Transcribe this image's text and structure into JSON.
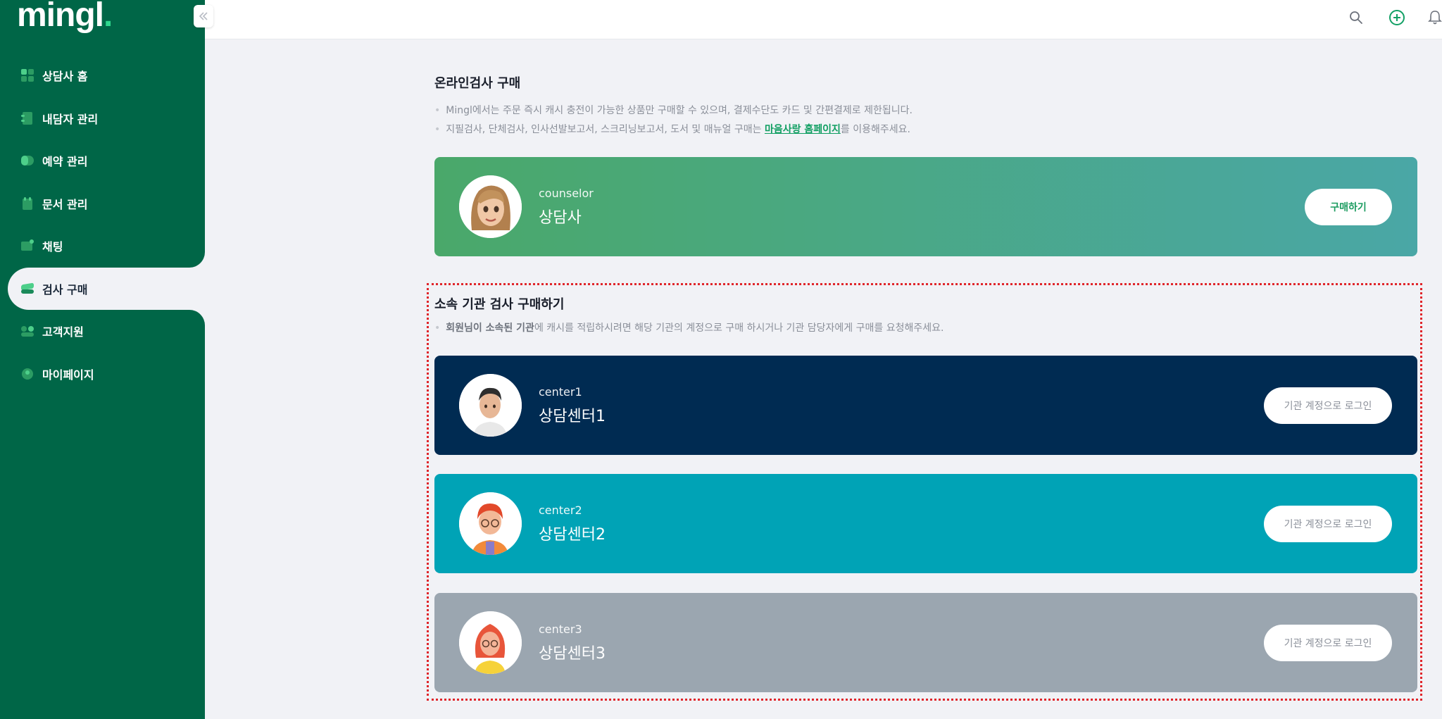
{
  "app": {
    "logo_text": "mingl",
    "logo_dot": "."
  },
  "sidebar": {
    "items": [
      {
        "label": "상담사 홈",
        "icon": "home-grid-icon",
        "active": false
      },
      {
        "label": "내담자 관리",
        "icon": "client-icon",
        "active": false
      },
      {
        "label": "예약 관리",
        "icon": "reservation-icon",
        "active": false
      },
      {
        "label": "문서 관리",
        "icon": "document-icon",
        "active": false
      },
      {
        "label": "채팅",
        "icon": "chat-icon",
        "active": false
      },
      {
        "label": "검사 구매",
        "icon": "stack-icon",
        "active": true
      },
      {
        "label": "고객지원",
        "icon": "support-icon",
        "active": false
      },
      {
        "label": "마이페이지",
        "icon": "user-icon",
        "active": false
      }
    ]
  },
  "topbar": {
    "icons": [
      "search-icon",
      "add-circle-icon",
      "bell-icon"
    ]
  },
  "online_section": {
    "title": "온라인검사 구매",
    "bullet1": "Mingl에서는 주문 즉시 캐시 충전이 가능한 상품만 구매할 수 있으며, 결제수단도 카드 및 간편결제로 제한됩니다.",
    "bullet2_before": "지필검사, 단체검사, 인사선발보고서, 스크리닝보고서, 도서 및 매뉴얼 구매는 ",
    "bullet2_link": "마음사랑 홈페이지",
    "bullet2_after": "를 이용해주세요.",
    "card": {
      "sub": "counselor",
      "name": "상담사",
      "button": "구매하기"
    }
  },
  "org_section": {
    "title": "소속 기관 검사 구매하기",
    "bullet_bold": "회원님이 소속된 기관",
    "bullet_rest": "에 캐시를 적립하시려면 해당 기관의 계정으로 구매 하시거나 기관 담당자에게 구매를 요청해주세요.",
    "cards": [
      {
        "sub": "center1",
        "name": "상담센터1",
        "button": "기관 계정으로 로그인",
        "color": "#002b52"
      },
      {
        "sub": "center2",
        "name": "상담센터2",
        "button": "기관 계정으로 로그인",
        "color": "#00a3b6"
      },
      {
        "sub": "center3",
        "name": "상담센터3",
        "button": "기관 계정으로 로그인",
        "color": "#9ba6b0"
      }
    ]
  },
  "colors": {
    "sidebar": "#006647",
    "accent": "#0f9e61",
    "counselor_gradient_start": "#4aa86a",
    "counselor_gradient_end": "#4aa7a6"
  }
}
